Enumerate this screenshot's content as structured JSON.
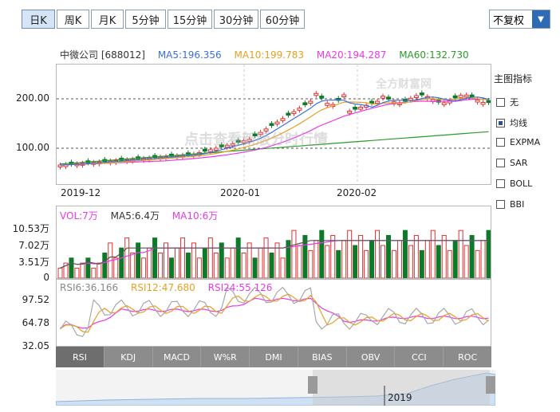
{
  "tabs": [
    {
      "label": "日K",
      "active": true
    },
    {
      "label": "周K",
      "active": false
    },
    {
      "label": "月K",
      "active": false
    },
    {
      "label": "5分钟",
      "active": false
    },
    {
      "label": "15分钟",
      "active": false
    },
    {
      "label": "30分钟",
      "active": false
    },
    {
      "label": "60分钟",
      "active": false
    }
  ],
  "fuquan": {
    "label": "不复权"
  },
  "header": {
    "name": "中微公司 [688012]",
    "ma5": "MA5:196.356",
    "ma10": "MA10:199.783",
    "ma20": "MA20:194.287",
    "ma60": "MA60:132.730"
  },
  "colors": {
    "ma5": "#3b6fe0",
    "ma10": "#e8a020",
    "ma20": "#e63be6",
    "ma60": "#2a9a2a",
    "up": "#e03030",
    "down": "#0d7a2a"
  },
  "kline": {
    "yticks": [
      "200.00",
      "100.00"
    ],
    "xticks": [
      "2019-12",
      "2020-01",
      "2020-02"
    ]
  },
  "sidebar": {
    "title": "主图指标",
    "items": [
      {
        "label": "无",
        "checked": false
      },
      {
        "label": "均线",
        "checked": true
      },
      {
        "label": "EXPMA",
        "checked": false
      },
      {
        "label": "SAR",
        "checked": false
      },
      {
        "label": "BOLL",
        "checked": false
      },
      {
        "label": "BBI",
        "checked": false
      }
    ]
  },
  "volume": {
    "vol": "VOL:7万",
    "ma5": "MA5:6.4万",
    "ma10": "MA10:6万",
    "yticks": [
      "10.53万",
      "7.02万",
      "3.51万",
      "0"
    ]
  },
  "rsi": {
    "rsi6": "RSI6:36.166",
    "rsi12": "RSI12:47.680",
    "rsi24": "RSI24:55.126",
    "yticks": [
      "97.52",
      "64.78",
      "32.05"
    ]
  },
  "indicator_tabs": [
    "RSI",
    "KDJ",
    "MACD",
    "W%R",
    "DMI",
    "BIAS",
    "OBV",
    "CCI",
    "ROC"
  ],
  "navigator": {
    "label": "2019"
  },
  "watermark": {
    "logo": "全方财富网",
    "text": "点击查看新版分时行情"
  }
}
